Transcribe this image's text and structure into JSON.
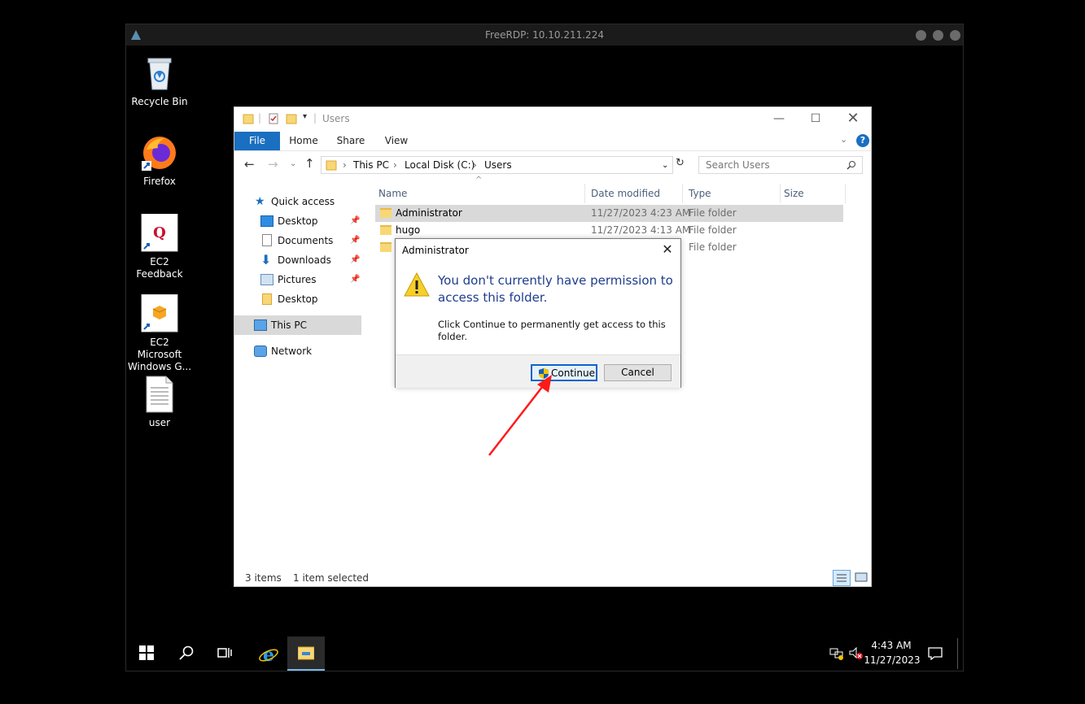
{
  "rdp": {
    "title": "FreeRDP: 10.10.211.224"
  },
  "desktop_icons": [
    {
      "label": "Recycle Bin"
    },
    {
      "label": "Firefox"
    },
    {
      "label": "EC2 Feedback"
    },
    {
      "label": "EC2 Microsoft Windows G..."
    },
    {
      "label": "user"
    }
  ],
  "explorer": {
    "title": "Users",
    "ribbon_tabs": [
      "File",
      "Home",
      "Share",
      "View"
    ],
    "breadcrumb": [
      "This PC",
      "Local Disk (C:)",
      "Users"
    ],
    "search_placeholder": "Search Users",
    "nav": {
      "quick_access": "Quick access",
      "desktop": "Desktop",
      "documents": "Documents",
      "downloads": "Downloads",
      "pictures": "Pictures",
      "desktop2": "Desktop",
      "this_pc": "This PC",
      "network": "Network"
    },
    "columns": [
      "Name",
      "Date modified",
      "Type",
      "Size"
    ],
    "rows": [
      {
        "name": "Administrator",
        "date": "11/27/2023 4:23 AM",
        "type": "File folder"
      },
      {
        "name": "hugo",
        "date": "11/27/2023 4:13 AM",
        "type": "File folder"
      },
      {
        "name": "",
        "date": "",
        "type": "File folder"
      }
    ],
    "status_items": "3 items",
    "status_selected": "1 item selected"
  },
  "dialog": {
    "title": "Administrator",
    "heading": "You don't currently have permission to access this folder.",
    "body": "Click Continue to permanently get access to this folder.",
    "continue_label": "Continue",
    "cancel_label": "Cancel"
  },
  "taskbar": {
    "time": "4:43 AM",
    "date": "11/27/2023"
  },
  "colors": {
    "accent": "#1a6fc0",
    "dialog_heading": "#1e3c8c",
    "selection": "#cce8ff",
    "annotation_arrow": "#ff1a1a"
  }
}
